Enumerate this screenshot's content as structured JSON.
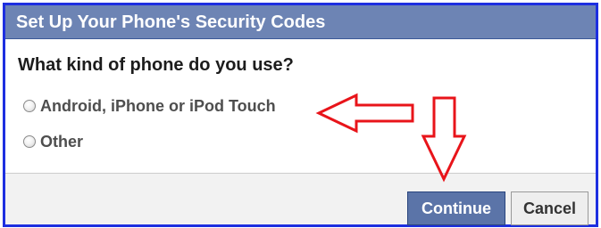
{
  "dialog": {
    "title": "Set Up Your Phone's Security Codes",
    "question": "What kind of phone do you use?",
    "options": [
      {
        "label": "Android, iPhone or iPod Touch",
        "selected": false
      },
      {
        "label": "Other",
        "selected": false
      }
    ]
  },
  "buttons": {
    "continue_label": "Continue",
    "cancel_label": "Cancel"
  },
  "colors": {
    "frame_border": "#1d2fe0",
    "header_bg": "#6d84b4",
    "primary_button": "#5b74a8",
    "annotation_arrow": "#e8141a"
  },
  "annotations": [
    {
      "type": "arrow",
      "direction": "left",
      "points_to": "radio-option-android"
    },
    {
      "type": "arrow",
      "direction": "down",
      "points_to": "continue-button"
    }
  ]
}
